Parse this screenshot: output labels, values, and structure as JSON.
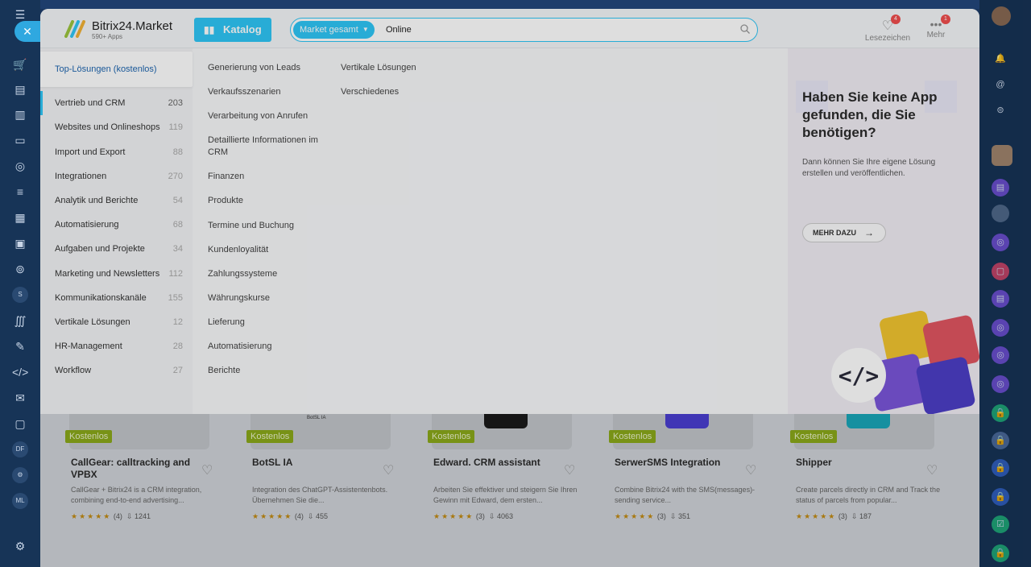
{
  "header": {
    "brand_title": "Bitrix24.Market",
    "brand_subtitle": "590+ Apps",
    "katalog_label": "Katalog",
    "search_scope": "Market gesamt",
    "search_value": "Online",
    "bookmarks_label": "Lesezeichen",
    "bookmarks_badge": "4",
    "more_label": "Mehr",
    "more_badge": "1"
  },
  "left_nav": {
    "badge": "1",
    "items": [
      "cart-icon",
      "document-icon",
      "building-icon",
      "card-icon",
      "target-icon",
      "filter-icon",
      "calendar-grid-icon",
      "briefcase-icon",
      "goal-icon",
      "s-circle",
      "market-icon",
      "pen-icon",
      "code-icon",
      "mail-icon",
      "calendar-icon",
      "df-circle",
      "gear-circle",
      "ml-circle",
      "settings-icon"
    ],
    "circle_labels": {
      "s": "S",
      "df": "DF",
      "ml": "ML"
    }
  },
  "categories": {
    "top_solutions": "Top-Lösungen (kostenlos)",
    "items": [
      {
        "label": "Vertrieb und CRM",
        "count": "203"
      },
      {
        "label": "Websites und Onlineshops",
        "count": "119"
      },
      {
        "label": "Import und Export",
        "count": "88"
      },
      {
        "label": "Integrationen",
        "count": "270"
      },
      {
        "label": "Analytik und Berichte",
        "count": "54"
      },
      {
        "label": "Automatisierung",
        "count": "68"
      },
      {
        "label": "Aufgaben und Projekte",
        "count": "34"
      },
      {
        "label": "Marketing und Newsletters",
        "count": "112"
      },
      {
        "label": "Kommunikationskanäle",
        "count": "155"
      },
      {
        "label": "Vertikale Lösungen",
        "count": "12"
      },
      {
        "label": "HR-Management",
        "count": "28"
      },
      {
        "label": "Workflow",
        "count": "27"
      }
    ]
  },
  "subcategories": {
    "col1": [
      "Generierung von Leads",
      "Verkaufsszenarien",
      "Verarbeitung von Anrufen",
      "Detaillierte Informationen im CRM",
      "Finanzen",
      "Produkte",
      "Termine und Buchung",
      "Kundenloyalität",
      "Zahlungssysteme",
      "Währungskurse",
      "Lieferung",
      "Automatisierung",
      "Berichte"
    ],
    "col2": [
      "Vertikale Lösungen",
      "Verschiedenes"
    ]
  },
  "promo": {
    "title": "Haben Sie keine App gefunden, die Sie benötigen?",
    "text": "Dann können Sie Ihre eigene Lösung erstellen und veröffentlichen.",
    "button": "MEHR DAZU"
  },
  "cards": [
    {
      "badge": "Kostenlos",
      "title": "CallGear: calltracking and VPBX",
      "desc": "CallGear + Bitrix24 is a CRM integration, combining end-to-end advertising...",
      "stars": "★★★★★",
      "rating_count": "(4)",
      "installs": "1241",
      "thumb_text": ""
    },
    {
      "badge": "Kostenlos",
      "title": "BotSL IA",
      "desc": "Integration des ChatGPT-Assistentenbots. Übernehmen Sie die...",
      "stars": "★★★★★",
      "rating_count": "(4)",
      "installs": "455",
      "thumb_text": "BotSL IA"
    },
    {
      "badge": "Kostenlos",
      "title": "Edward. CRM assistant",
      "desc": "Arbeiten Sie effektiver und steigern Sie Ihren Gewinn mit Edward, dem ersten...",
      "stars": "★★★★★",
      "rating_count": "(3)",
      "installs": "4063",
      "thumb_text": ""
    },
    {
      "badge": "Kostenlos",
      "title": "SerwerSMS Integration",
      "desc": "Combine Bitrix24 with the SMS(messages)-sending service...",
      "stars": "★★★★★",
      "rating_count": "(3)",
      "installs": "351",
      "thumb_text": ""
    },
    {
      "badge": "Kostenlos",
      "title": "Shipper",
      "desc": "Create parcels directly in CRM and Track the status of parcels from popular...",
      "stars": "★★★★★",
      "rating_count": "(3)",
      "installs": "187",
      "thumb_text": ""
    }
  ],
  "colors": {
    "accent": "#2fc6f6",
    "link": "#2067b0",
    "badge_green": "#8aa81a",
    "sidebar": "#173457",
    "notification": "#f04e4e"
  }
}
